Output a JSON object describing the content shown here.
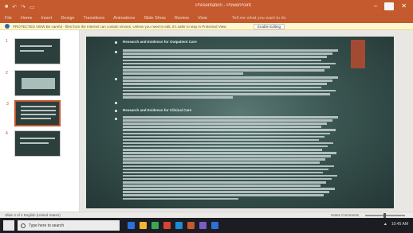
{
  "titlebar": {
    "qa_icons": [
      "save-icon",
      "undo-icon",
      "redo-icon",
      "present-icon"
    ],
    "title": "Presentation - PowerPoint",
    "controls": [
      "minimize-icon",
      "restore-icon",
      "close-icon"
    ]
  },
  "ribbon": {
    "tabs": [
      "File",
      "Home",
      "Insert",
      "Design",
      "Transitions",
      "Animations",
      "Slide Show",
      "Review",
      "View"
    ],
    "tell_me": "Tell me what you want to do"
  },
  "infobar": {
    "message": "PROTECTED VIEW  Be careful - files from the Internet can contain viruses. Unless you need to edit, it's safer to stay in Protected View.",
    "button_label": "Enable Editing"
  },
  "thumbnails": [
    {
      "number": "1"
    },
    {
      "number": "2"
    },
    {
      "number": "3"
    },
    {
      "number": "4"
    }
  ],
  "slide": {
    "heading_1": "Research and Evidence for Outpatient Care",
    "heading_2": "Research and Evidence for Clinical Care"
  },
  "statusbar": {
    "left": "Slide 3 of 4   English (United States)",
    "right": "Notes   Comments"
  },
  "taskbar": {
    "search_placeholder": "Type here to search",
    "time": "10:45 AM",
    "app_colors": [
      "#2d6fdb",
      "#f2b632",
      "#3aa655",
      "#d8442f",
      "#1f8ad6",
      "#c55a2f",
      "#7a5cc7",
      "#2d6fdb"
    ]
  }
}
